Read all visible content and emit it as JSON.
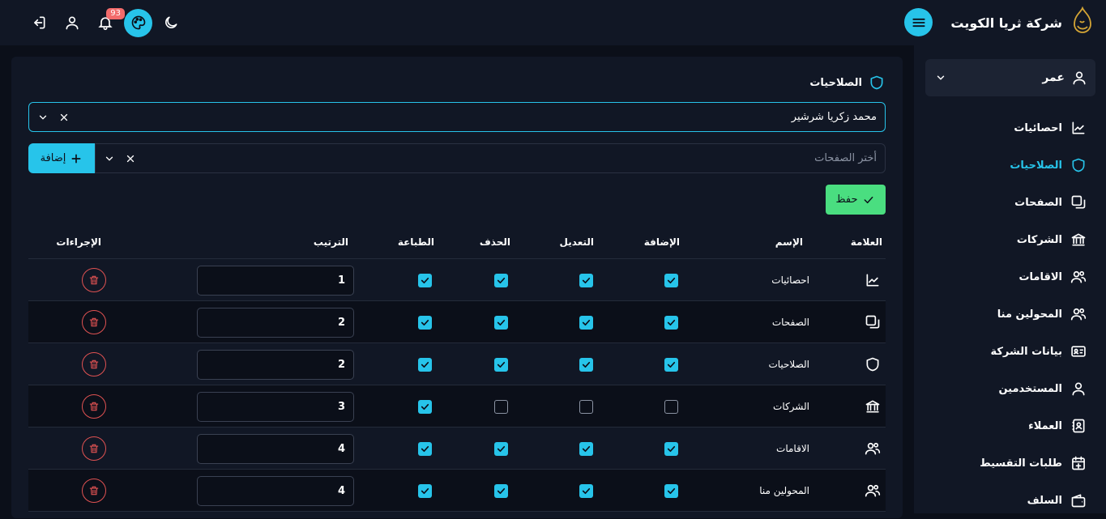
{
  "brand": {
    "name": "شركة ثريا الكويت"
  },
  "topbar": {
    "notifications_count": "93"
  },
  "sidebar": {
    "user_name": "عمر",
    "items": [
      {
        "label": "احصائيات",
        "icon": "chart-icon",
        "active": false
      },
      {
        "label": "الصلاحيات",
        "icon": "shield-icon",
        "active": true
      },
      {
        "label": "الصفحات",
        "icon": "pages-icon",
        "active": false
      },
      {
        "label": "الشركات",
        "icon": "bank-icon",
        "active": false
      },
      {
        "label": "الاقامات",
        "icon": "users-icon",
        "active": false
      },
      {
        "label": "المحولين منا",
        "icon": "users-icon",
        "active": false
      },
      {
        "label": "بيانات الشركة",
        "icon": "id-card-icon",
        "active": false
      },
      {
        "label": "المستخدمين",
        "icon": "user-icon",
        "active": false
      },
      {
        "label": "العملاء",
        "icon": "contacts-icon",
        "active": false
      },
      {
        "label": "طلبات التقسيط",
        "icon": "calendar-plus-icon",
        "active": false
      },
      {
        "label": "السلف",
        "icon": "wallet-icon",
        "active": false
      }
    ]
  },
  "main": {
    "title": "الصلاحيات",
    "user_select_value": "محمد زكريا شرشير",
    "pages_select_placeholder": "أختر الصفحات",
    "add_label": "إضافة",
    "save_label": "حفظ",
    "columns": {
      "icon": "العلامة",
      "name": "الإسم",
      "add": "الإضافة",
      "edit": "التعديل",
      "delete": "الحذف",
      "print": "الطباعة",
      "order": "الترتيب",
      "actions": "الإجراءات"
    },
    "rows": [
      {
        "icon": "chart-icon",
        "name": "احصائيات",
        "add": true,
        "edit": true,
        "delete": true,
        "print": true,
        "order": "1"
      },
      {
        "icon": "pages-icon",
        "name": "الصفحات",
        "add": true,
        "edit": true,
        "delete": true,
        "print": true,
        "order": "2"
      },
      {
        "icon": "shield-icon",
        "name": "الصلاحيات",
        "add": true,
        "edit": true,
        "delete": true,
        "print": true,
        "order": "2"
      },
      {
        "icon": "bank-icon",
        "name": "الشركات",
        "add": false,
        "edit": false,
        "delete": false,
        "print": true,
        "order": "3"
      },
      {
        "icon": "users-icon",
        "name": "الاقامات",
        "add": true,
        "edit": true,
        "delete": true,
        "print": true,
        "order": "4"
      },
      {
        "icon": "users-icon",
        "name": "المحولين منا",
        "add": true,
        "edit": true,
        "delete": true,
        "print": true,
        "order": "4"
      }
    ]
  },
  "colors": {
    "accent": "#27c4ea",
    "success": "#4ade80",
    "danger": "#e05252",
    "panel": "#111725",
    "background": "#0b0f19"
  }
}
